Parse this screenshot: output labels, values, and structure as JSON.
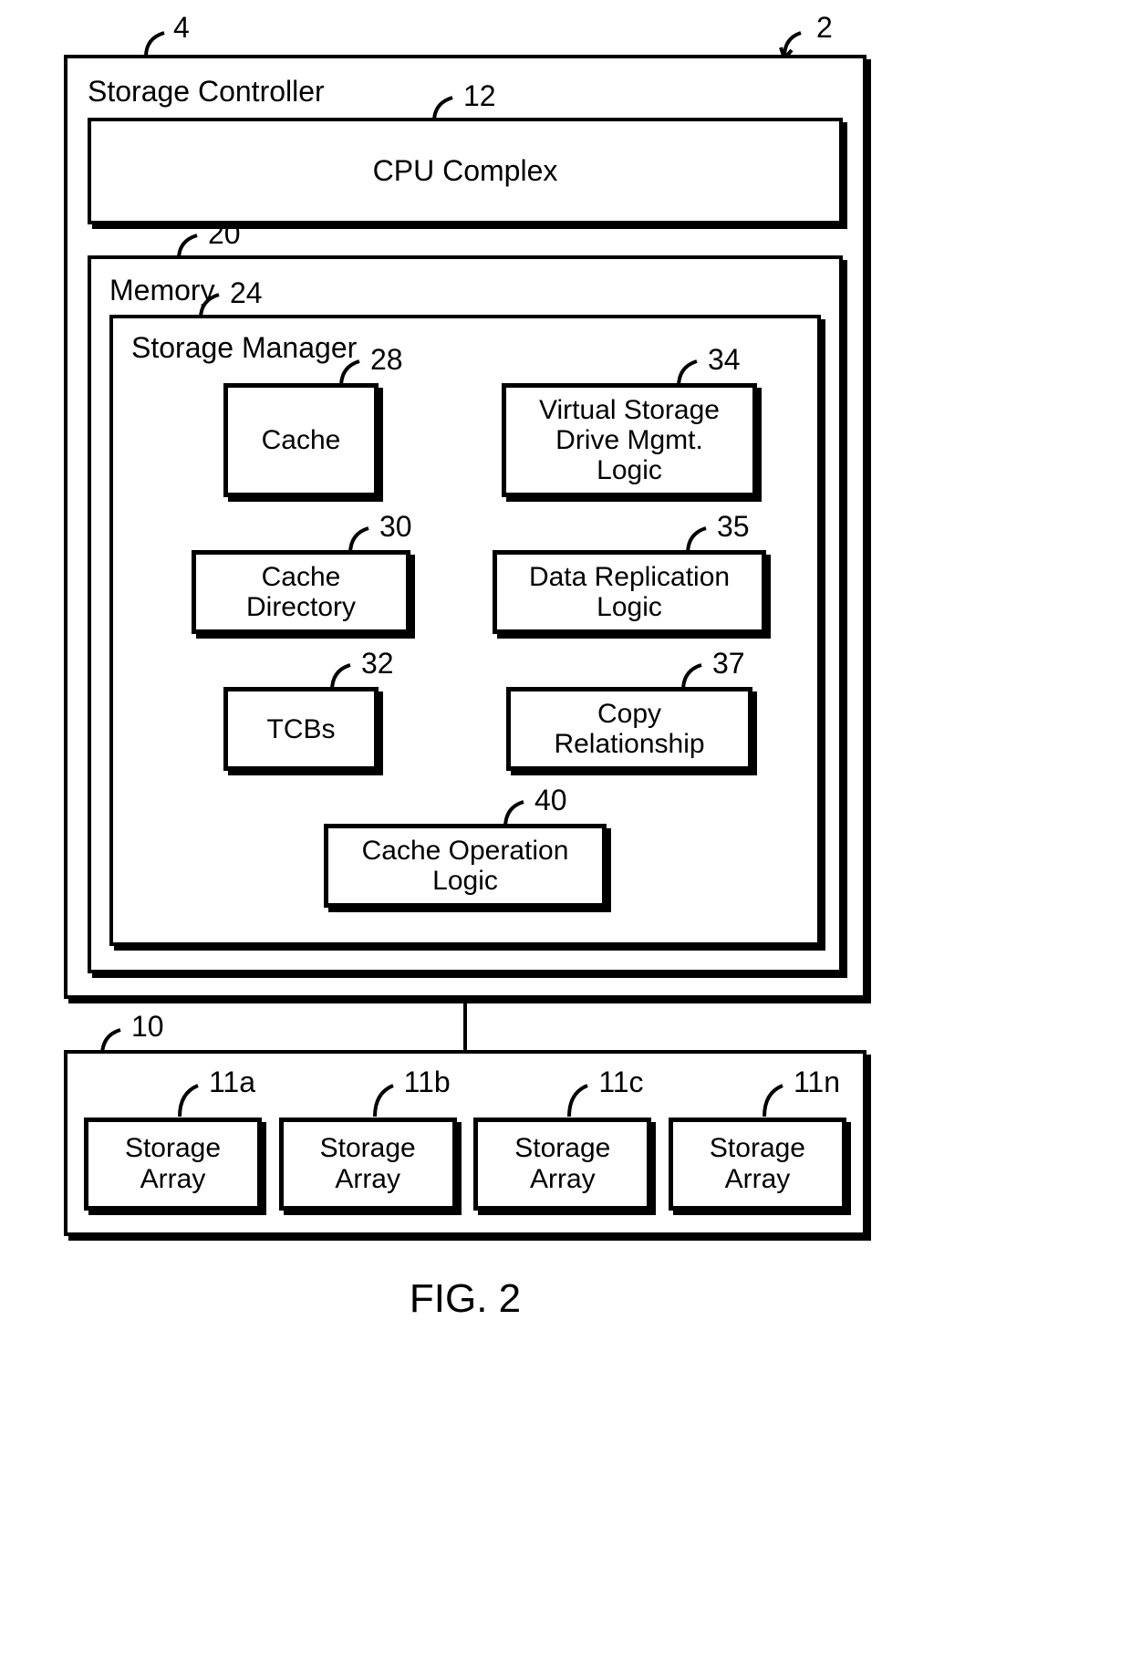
{
  "figure_caption": "FIG. 2",
  "refs": {
    "system": "2",
    "controller": "4",
    "storage_outer": "10",
    "arrays": [
      "11a",
      "11b",
      "11c",
      "11n"
    ],
    "cpu": "12",
    "memory": "20",
    "manager": "24",
    "cache": "28",
    "cache_dir": "30",
    "tcbs": "32",
    "vsd": "34",
    "repl": "35",
    "copy": "37",
    "cache_op": "40"
  },
  "labels": {
    "controller": "Storage Controller",
    "cpu": "CPU Complex",
    "memory": "Memory",
    "manager": "Storage Manager",
    "cache": "Cache",
    "vsd": "Virtual Storage Drive Mgmt. Logic",
    "cache_dir": "Cache Directory",
    "repl": "Data Replication Logic",
    "tcbs": "TCBs",
    "copy": "Copy Relationship",
    "cache_op": "Cache Operation Logic",
    "array": "Storage Array"
  }
}
